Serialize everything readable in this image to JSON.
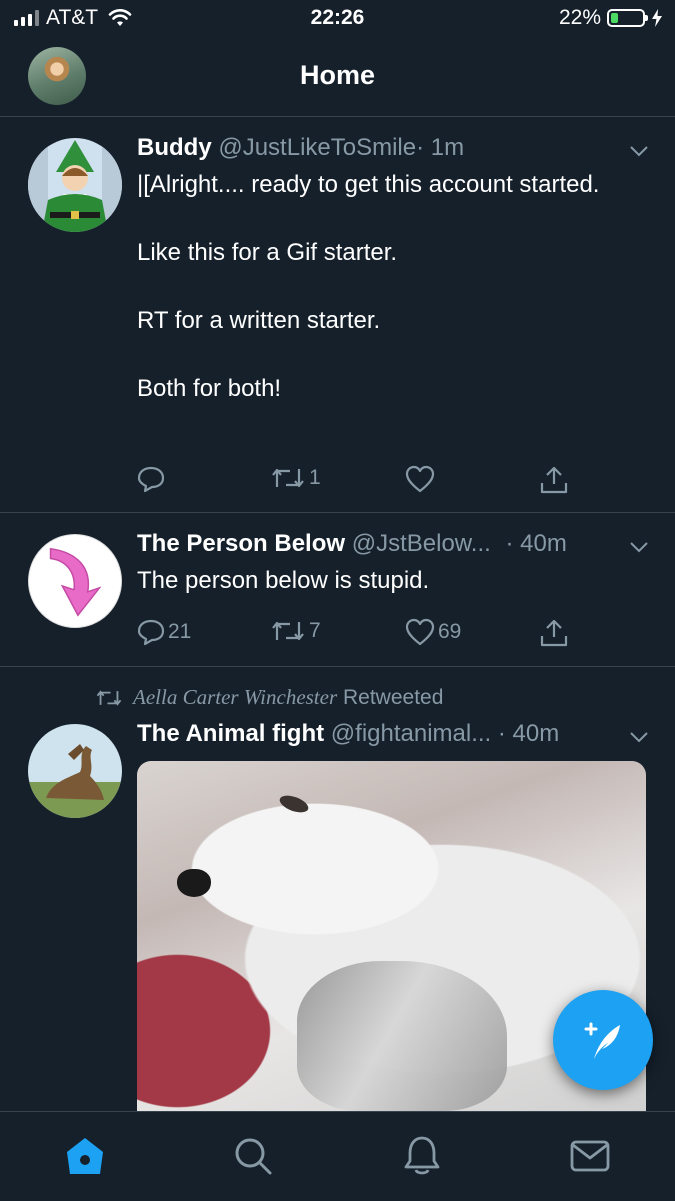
{
  "status_bar": {
    "carrier": "AT&T",
    "time": "22:26",
    "battery_percent": "22%",
    "battery_level": 0.22,
    "icons": [
      "signal-icon",
      "wifi-icon",
      "battery-icon",
      "charging-bolt-icon"
    ]
  },
  "header": {
    "title": "Home"
  },
  "tweets": [
    {
      "name": "Buddy",
      "handle": "@JustLikeToSmile",
      "time": "· 1m",
      "text": "|[Alright.... ready to get this account started.\n\nLike this for a Gif starter.\n\nRT for a written starter.\n\nBoth for both!",
      "replies": "",
      "retweets": "1",
      "likes": ""
    },
    {
      "name": "The Person Below",
      "handle": "@JstBelow...",
      "time": "· 40m",
      "text": "The person below is stupid.",
      "replies": "21",
      "retweets": "7",
      "likes": "69"
    },
    {
      "retweeted_by": "Aella Carter Winchester",
      "retweeted_label": "Retweeted",
      "name": "The Animal fight",
      "handle": "@fightanimal...",
      "time": "· 40m"
    }
  ],
  "colors": {
    "background": "#15202b",
    "divider": "#38444d",
    "secondary_text": "#8899a6",
    "accent": "#1da1f2"
  },
  "tab_bar": {
    "icons": [
      "home-icon",
      "search-icon",
      "notifications-icon",
      "messages-icon"
    ],
    "active": "home"
  }
}
